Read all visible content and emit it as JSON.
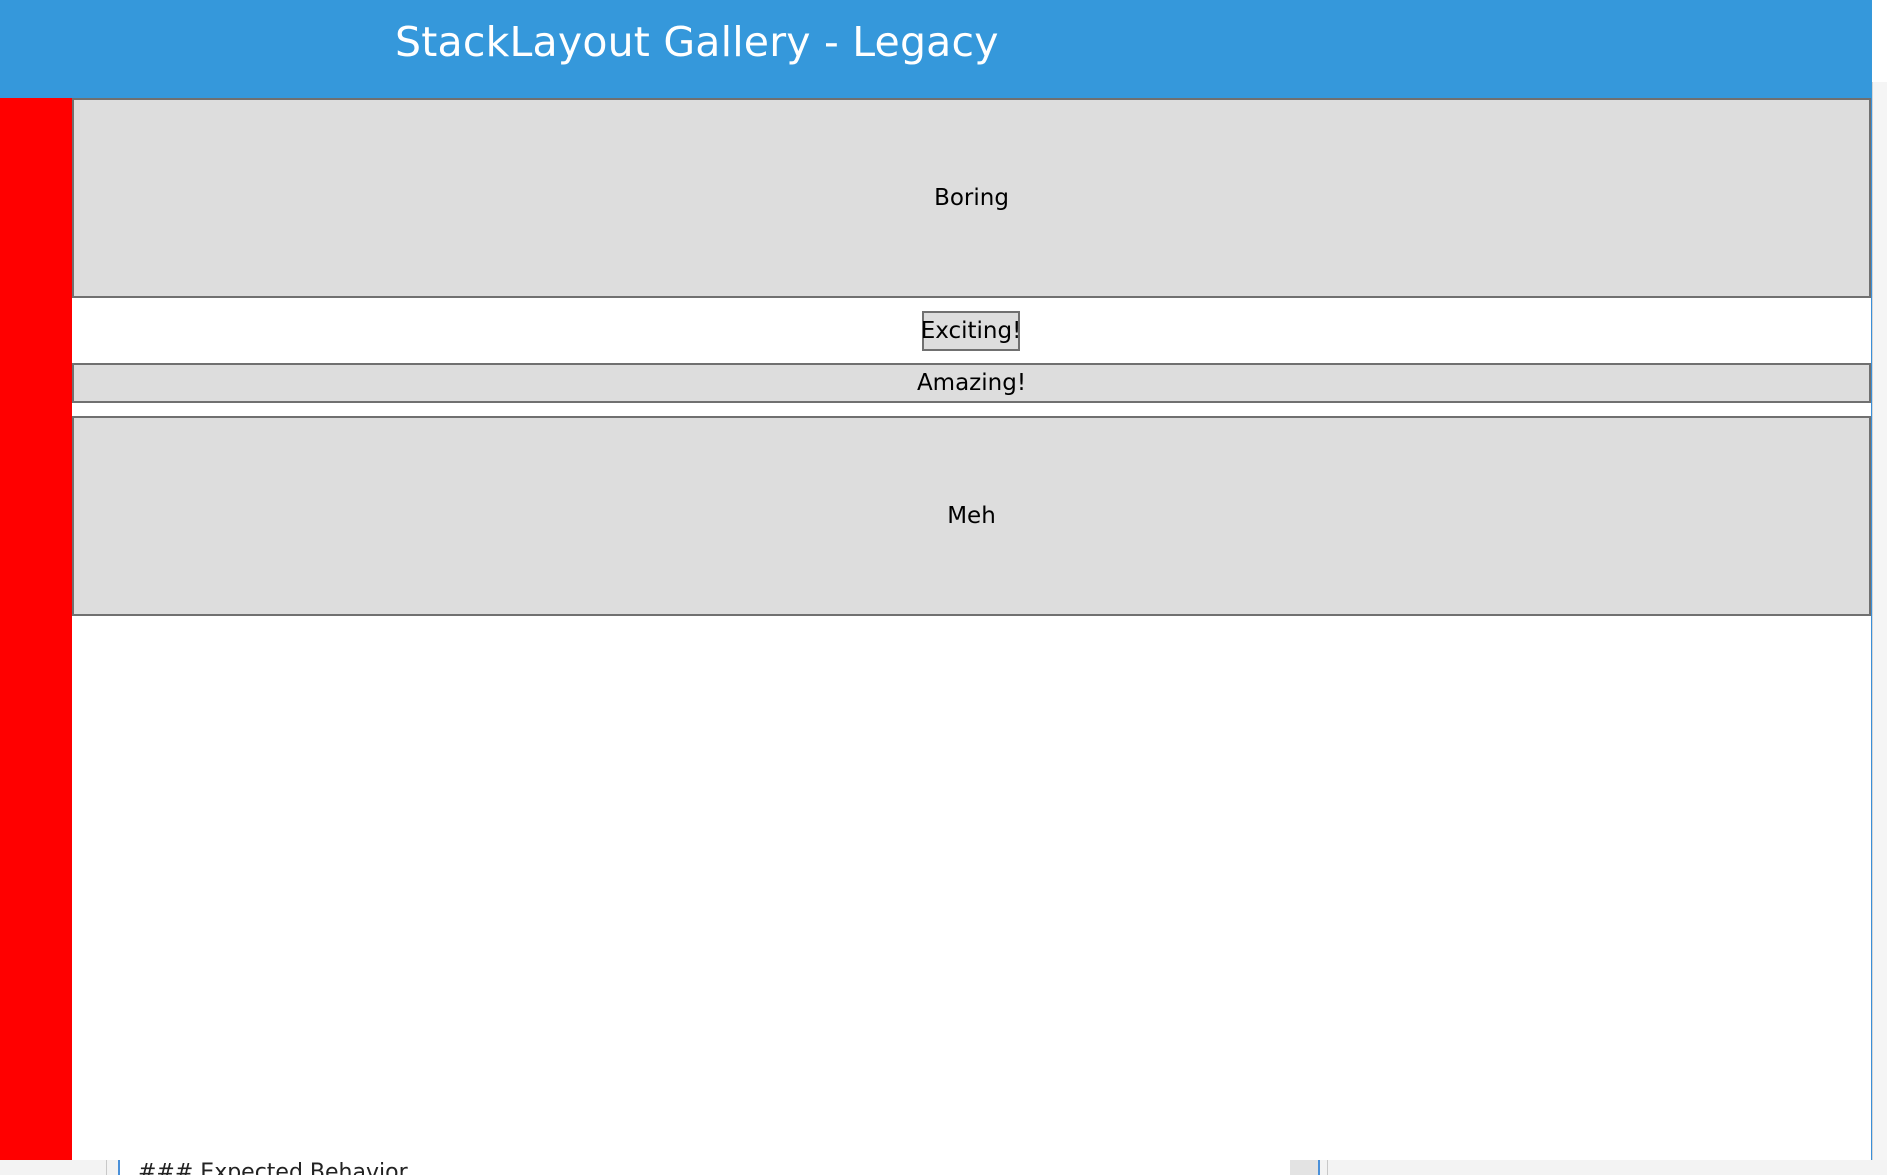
{
  "window": {
    "title": "StackLayout Gallery - Legacy"
  },
  "stack": {
    "buttons": [
      {
        "label": "Boring"
      },
      {
        "label": "Exciting!"
      },
      {
        "label": "Amazing!"
      },
      {
        "label": "Meh"
      }
    ]
  },
  "background_editor": {
    "text": "### Expected Behavior"
  },
  "colors": {
    "titlebar": "#3598db",
    "side_bar": "#ff0000",
    "button_fill": "#dddddd",
    "button_border": "#707070"
  }
}
